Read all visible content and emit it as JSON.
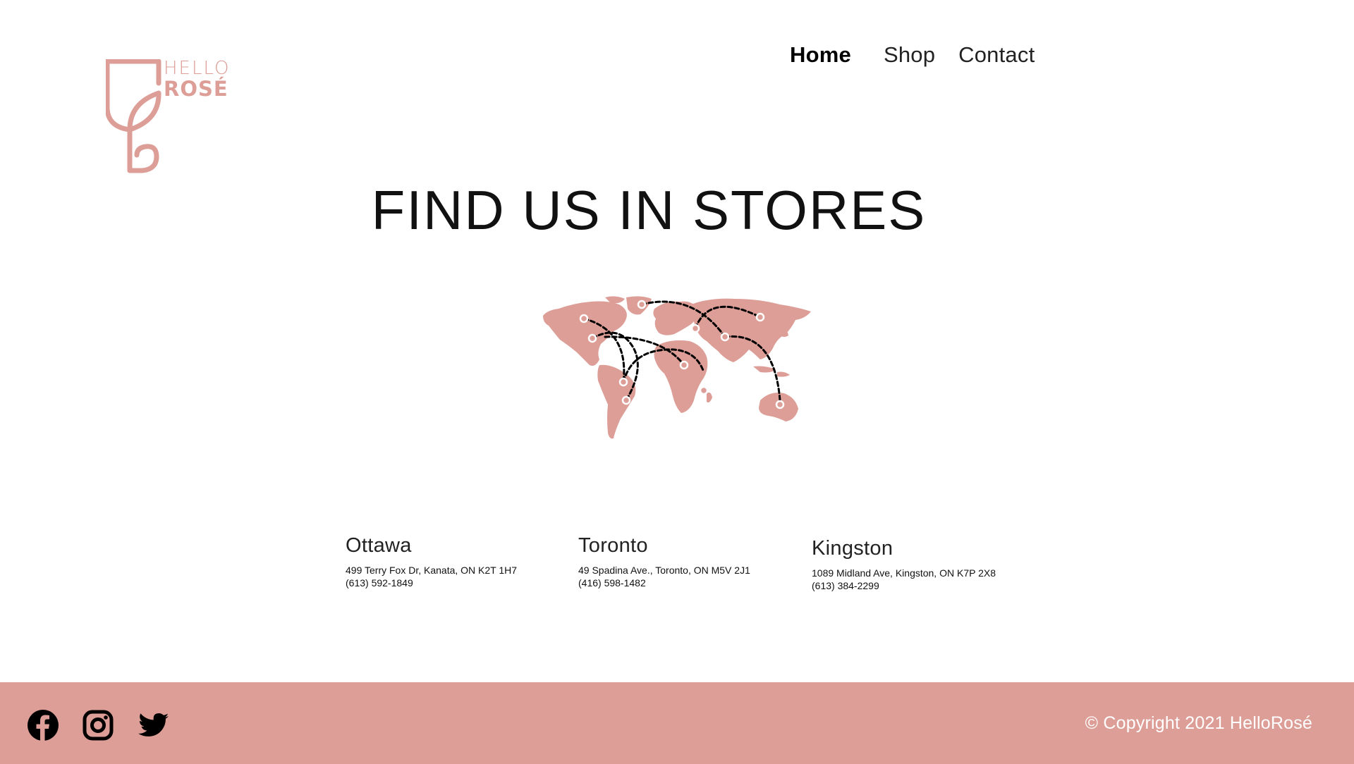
{
  "brand": {
    "logo_line1": "HELLO",
    "logo_line2": "ROSÉ",
    "color": "#dd9e97"
  },
  "nav": {
    "items": [
      {
        "label": "Home",
        "active": true
      },
      {
        "label": "Shop",
        "active": false
      },
      {
        "label": "Contact",
        "active": false
      }
    ]
  },
  "main": {
    "title": "FIND US IN STORES",
    "map_icon": "world-map-icon"
  },
  "stores": [
    {
      "city": "Ottawa",
      "address": "499 Terry Fox Dr, Kanata, ON K2T 1H7",
      "phone": "(613) 592-1849"
    },
    {
      "city": "Toronto",
      "address": "49 Spadina Ave., Toronto, ON M5V 2J1",
      "phone": "(416) 598-1482"
    },
    {
      "city": "Kingston",
      "address": "1089 Midland Ave, Kingston, ON K7P 2X8",
      "phone": "(613) 384-2299"
    }
  ],
  "footer": {
    "copyright": "© Copyright 2021 HelloRosé",
    "background": "#dd9e97",
    "social": [
      "facebook-icon",
      "instagram-icon",
      "twitter-icon"
    ]
  }
}
